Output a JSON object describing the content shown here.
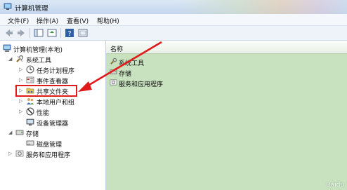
{
  "window": {
    "title": "计算机管理"
  },
  "menu": {
    "file": "文件(F)",
    "action": "操作(A)",
    "view": "查看(V)",
    "help": "帮助(H)"
  },
  "tree": {
    "root": "计算机管理(本地)",
    "system_tools": "系统工具",
    "task_scheduler": "任务计划程序",
    "event_viewer": "事件查看器",
    "shared_folders": "共享文件夹",
    "local_users": "本地用户和组",
    "performance": "性能",
    "device_manager": "设备管理器",
    "storage": "存储",
    "disk_management": "磁盘管理",
    "services_apps": "服务和应用程序"
  },
  "list": {
    "column_name": "名称",
    "items": [
      "系统工具",
      "存储",
      "服务和应用程序"
    ]
  },
  "watermark": "Baidu"
}
